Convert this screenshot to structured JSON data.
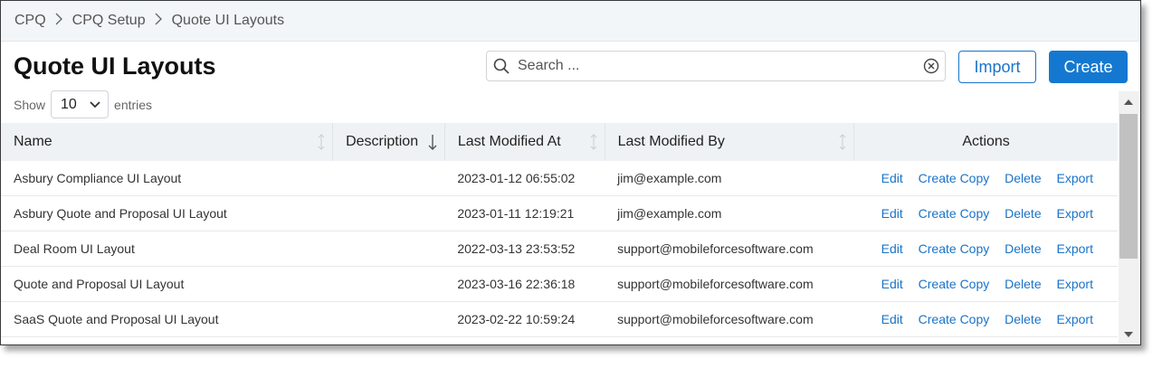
{
  "breadcrumb": {
    "items": [
      "CPQ",
      "CPQ Setup",
      "Quote UI Layouts"
    ]
  },
  "page": {
    "title": "Quote UI Layouts"
  },
  "search": {
    "placeholder": "Search ..."
  },
  "buttons": {
    "import": "Import",
    "create": "Create"
  },
  "entries": {
    "show_label": "Show",
    "value": "10",
    "suffix": "entries"
  },
  "table": {
    "columns": [
      "Name",
      "Description",
      "Last Modified At",
      "Last Modified By",
      "Actions"
    ],
    "actions": [
      "Edit",
      "Create Copy",
      "Delete",
      "Export"
    ],
    "rows": [
      {
        "name": "Asbury Compliance UI Layout",
        "description": "",
        "modified_at": "2023-01-12 06:55:02",
        "modified_by": "jim@example.com"
      },
      {
        "name": "Asbury Quote and Proposal UI Layout",
        "description": "",
        "modified_at": "2023-01-11 12:19:21",
        "modified_by": "jim@example.com"
      },
      {
        "name": "Deal Room UI Layout",
        "description": "",
        "modified_at": "2022-03-13 23:53:52",
        "modified_by": "support@mobileforcesoftware.com"
      },
      {
        "name": "Quote and Proposal UI Layout",
        "description": "",
        "modified_at": "2023-03-16 22:36:18",
        "modified_by": "support@mobileforcesoftware.com"
      },
      {
        "name": "SaaS Quote and Proposal UI Layout",
        "description": "",
        "modified_at": "2023-02-22 10:59:24",
        "modified_by": "support@mobileforcesoftware.com"
      }
    ]
  },
  "colors": {
    "accent": "#1578d0",
    "link": "#1a73c8",
    "header_bg": "#eef2f5"
  }
}
